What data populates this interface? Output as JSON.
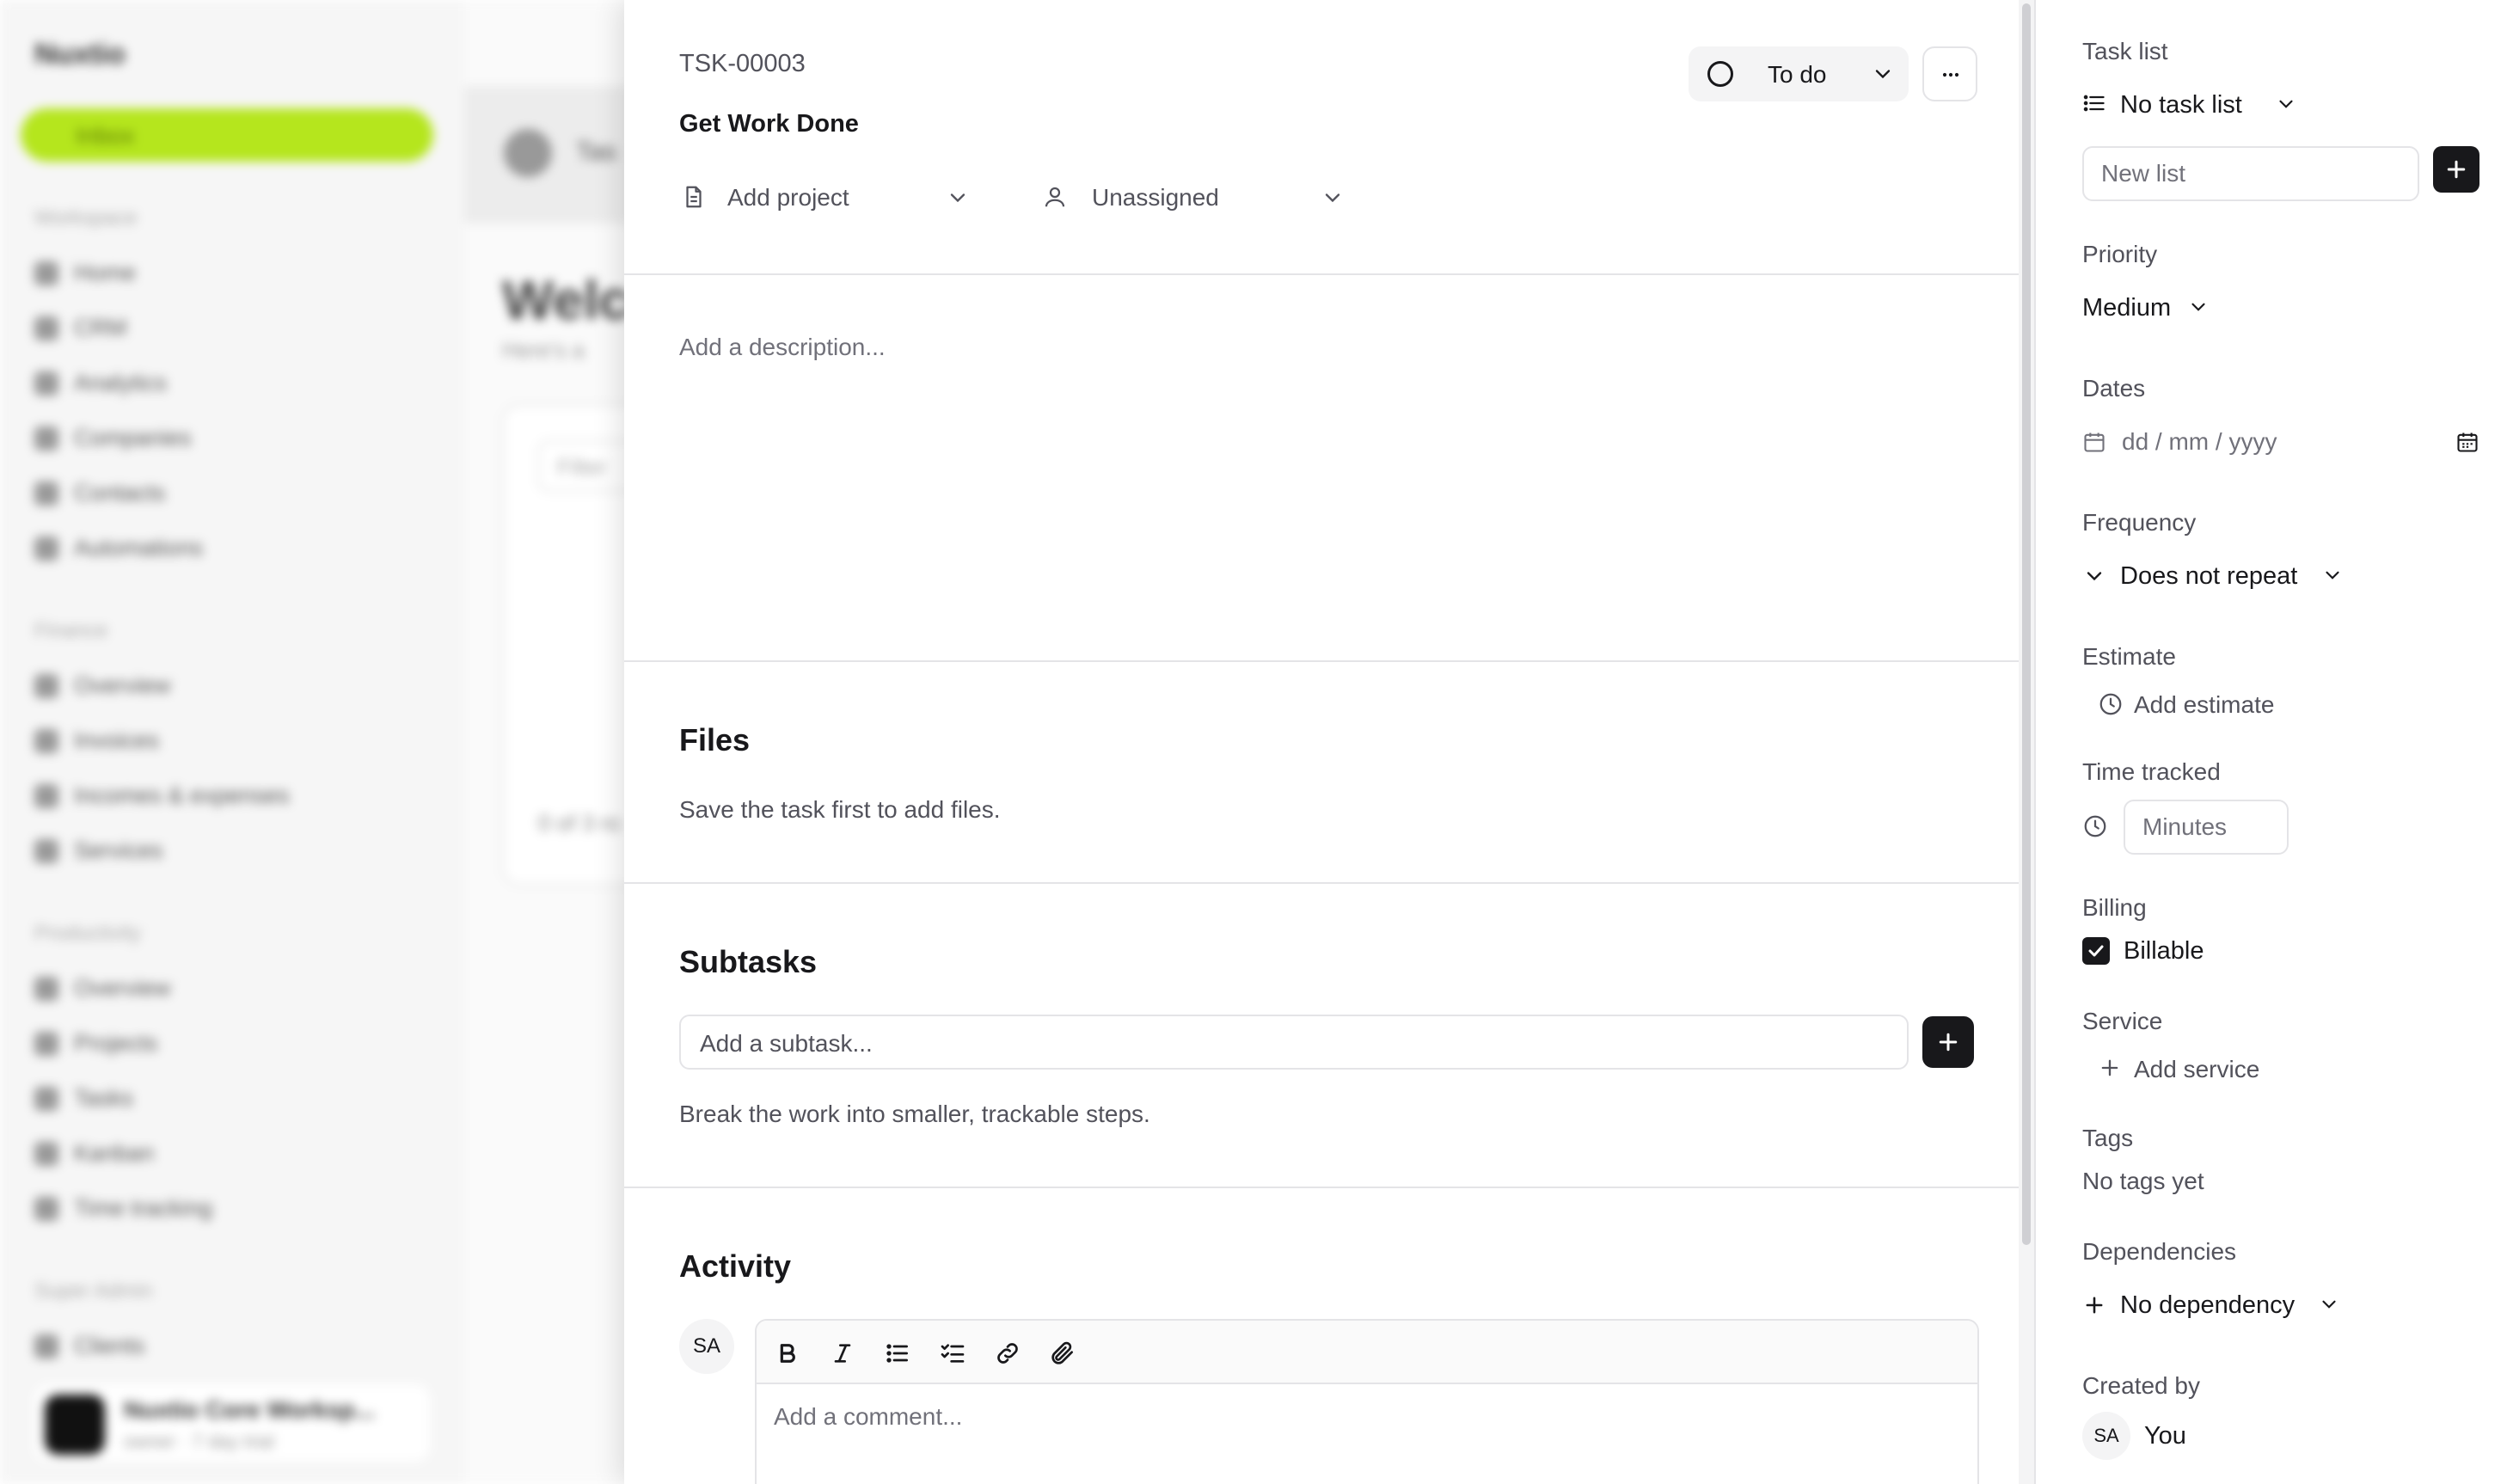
{
  "background": {
    "brand": "Nuxtio",
    "active_nav": "Inbox",
    "sections": [
      {
        "label": "Workspace",
        "items": [
          "Home",
          "CRM",
          "Analytics",
          "Companies",
          "Contacts",
          "Automations"
        ]
      },
      {
        "label": "Finance",
        "items": [
          "Overview",
          "Invoices",
          "Incomes & expenses",
          "Services"
        ]
      },
      {
        "label": "Productivity",
        "items": [
          "Overview",
          "Projects",
          "Tasks",
          "Kanban",
          "Time tracking"
        ]
      },
      {
        "label": "Super Admin",
        "items": [
          "Clients"
        ]
      }
    ],
    "workspace_name": "Nuxtio Core Worksp...",
    "workspace_sub": "owner · 7 day trial",
    "page_title": "Welco",
    "page_subtitle": "Here's a",
    "top_label": "Tas",
    "card_filter": "Filter",
    "card_footer": "0 of 3 ro"
  },
  "task": {
    "id": "TSK-00003",
    "title": "Get Work Done",
    "status": "To do",
    "project_placeholder": "Add project",
    "assignee": "Unassigned",
    "description_placeholder": "Add a description..."
  },
  "files": {
    "heading": "Files",
    "note": "Save the task first to add files."
  },
  "subtasks": {
    "heading": "Subtasks",
    "placeholder": "Add a subtask...",
    "hint": "Break the work into smaller, trackable steps."
  },
  "activity": {
    "heading": "Activity",
    "avatar_initials": "SA",
    "comment_placeholder": "Add a comment..."
  },
  "sidebar": {
    "task_list_label": "Task list",
    "task_list_value": "No task list",
    "new_list_placeholder": "New list",
    "priority_label": "Priority",
    "priority_value": "Medium",
    "dates_label": "Dates",
    "dates_placeholder": "dd / mm / yyyy",
    "frequency_label": "Frequency",
    "frequency_value": "Does not repeat",
    "estimate_label": "Estimate",
    "estimate_action": "Add estimate",
    "time_tracked_label": "Time tracked",
    "minutes_placeholder": "Minutes",
    "billing_label": "Billing",
    "billable_label": "Billable",
    "billable_checked": true,
    "service_label": "Service",
    "service_action": "Add service",
    "tags_label": "Tags",
    "tags_value": "No tags yet",
    "dependencies_label": "Dependencies",
    "dependency_value": "No dependency",
    "created_by_label": "Created by",
    "created_by_initials": "SA",
    "created_by_value": "You"
  },
  "colors": {
    "accent": "#b5e61d",
    "dark": "#18181b",
    "muted": "#71717a",
    "border": "#e4e4e7"
  }
}
